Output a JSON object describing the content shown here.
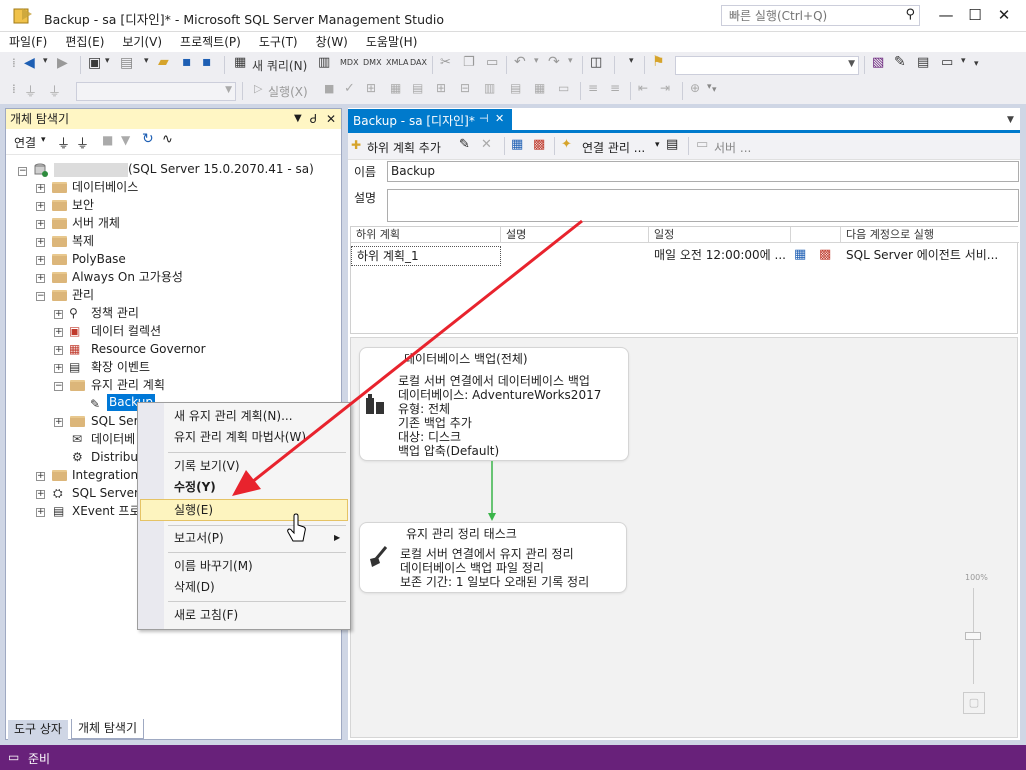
{
  "window": {
    "title": "Backup - sa [디자인]* - Microsoft SQL Server Management Studio",
    "quick_launch_placeholder": "빠른 실행(Ctrl+Q)",
    "controls": {
      "minimize": "—",
      "maximize": "☐",
      "close": "✕"
    }
  },
  "menu": [
    "파일(F)",
    "편집(E)",
    "보기(V)",
    "프로젝트(P)",
    "도구(T)",
    "창(W)",
    "도움말(H)"
  ],
  "toolbar1": {
    "new_query": "새 쿼리(N)",
    "mdx": "MDX",
    "dmx": "DMX",
    "xmla": "XMLA",
    "dax": "DAX"
  },
  "toolbar2": {
    "execute": "실행(X)"
  },
  "object_explorer": {
    "title": "개체 탐색기",
    "pin": "ᅮ 부 ✕",
    "connect_label": "연결",
    "server_node": "(SQL Server 15.0.2070.41 - sa)",
    "nodes": {
      "databases": "데이터베이스",
      "security": "보안",
      "server_objects": "서버 개체",
      "replication": "복제",
      "polybase": "PolyBase",
      "always_on": "Always On 고가용성",
      "management": "관리",
      "policy_management": "정책 관리",
      "data_collection": "데이터 컬렉션",
      "resource_governor": "Resource Governor",
      "extended_events": "확장 이벤트",
      "maintenance_plans": "유지 관리 계획",
      "backup": "Backup",
      "sql_server_logs": "SQL Serv",
      "database_mail": "데이터베",
      "dtc": "Distribut",
      "integration_services": "Integration S",
      "sql_server_agent": "SQL Server",
      "xevent_profiler": "XEvent 프로"
    }
  },
  "bottom_tabs": {
    "toolbox": "도구 상자",
    "object_explorer": "개체 탐색기"
  },
  "status": {
    "text": "준비"
  },
  "designer": {
    "tab_label": "Backup - sa [디자인]*",
    "tab_pin": "⊣",
    "tab_close": "✕",
    "toolbar": {
      "add_subplan": "하위 계획 추가",
      "manage_connections": "연결 관리 ...",
      "servers": "서버 ..."
    },
    "name_label": "이름",
    "name_value": "Backup",
    "desc_label": "설명",
    "desc_value": "",
    "grid": {
      "headers": [
        "하위 계획",
        "설명",
        "일정",
        "다음 계정으로 실행"
      ],
      "rows": [
        {
          "subplan": "하위 계획_1",
          "description": "",
          "schedule": "매일 오전 12:00:00에 ...",
          "run_as": "SQL Server 에이전트 서비..."
        }
      ]
    },
    "tasks": [
      {
        "title": "데이터베이스 백업(전체)",
        "lines": [
          "로컬 서버 연결에서 데이터베이스 백업",
          "데이터베이스: AdventureWorks2017",
          "유형: 전체",
          "기존 백업 추가",
          "대상: 디스크",
          "백업 압축(Default)"
        ]
      },
      {
        "title": "유지 관리 정리 태스크",
        "lines": [
          "로컬 서버 연결에서 유지 관리 정리",
          "데이터베이스 백업 파일 정리",
          "보존 기간: 1 일보다 오래된 기록 정리"
        ]
      }
    ],
    "zoom_label": "100%"
  },
  "context_menu": {
    "items": {
      "new_plan": "새 유지 관리 계획(N)...",
      "wizard": "유지 관리 계획 마법사(W)",
      "view_history": "기록 보기(V)",
      "modify": "수정(Y)",
      "execute": "실행(E)",
      "reports": "보고서(P)",
      "rename": "이름 바꾸기(M)",
      "delete": "삭제(D)",
      "refresh": "새로 고침(F)"
    },
    "submenu_arrow": "▶"
  },
  "colors": {
    "accent": "#007acc",
    "status_bar": "#68217a",
    "annotation_arrow": "#e8232d",
    "highlight": "#fdf4bf",
    "panel_title": "#fff6c4"
  }
}
